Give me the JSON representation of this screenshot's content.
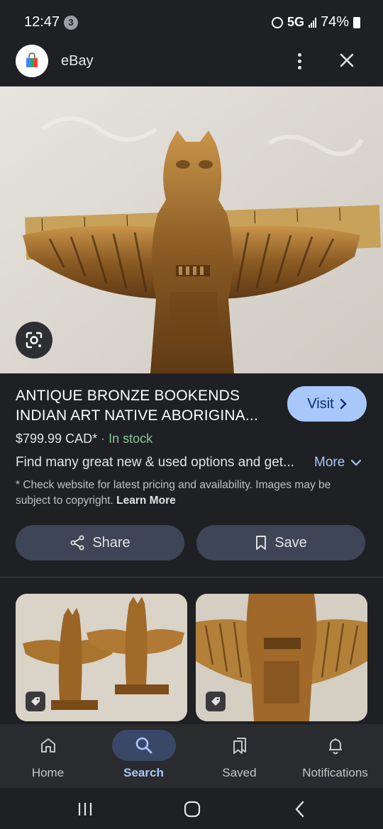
{
  "status_bar": {
    "time": "12:47",
    "notification_count": "3",
    "network": "5G",
    "battery": "74%"
  },
  "header": {
    "title": "eBay",
    "logo_icon": "google-lens-shopping-bag-icon",
    "menu_icon": "more-vert-icon",
    "close_icon": "close-icon"
  },
  "hero_image": {
    "subject": "bronze totem figure with ruler",
    "lens_icon": "google-lens-icon"
  },
  "product": {
    "title": "ANTIQUE BRONZE BOOKENDS INDIAN ART NATIVE ABORIGINA...",
    "visit_label": "Visit",
    "price": "$799.99 CAD*",
    "separator": "·",
    "stock": "In stock",
    "description": "Find many great new & used options and get...",
    "more_label": "More",
    "disclaimer": "* Check website for latest pricing and availability. Images may be subject to copyright.",
    "learn_more": "Learn More"
  },
  "actions": {
    "share_label": "Share",
    "save_label": "Save"
  },
  "related": [
    {
      "name": "related-thumb-pair",
      "tag_icon": "tag-icon"
    },
    {
      "name": "related-thumb-closeup",
      "tag_icon": "tag-icon"
    }
  ],
  "bottom_nav": {
    "items": [
      {
        "label": "Home",
        "icon": "home-icon",
        "active": false
      },
      {
        "label": "Search",
        "icon": "search-icon",
        "active": true
      },
      {
        "label": "Saved",
        "icon": "bookmarks-icon",
        "active": false
      },
      {
        "label": "Notifications",
        "icon": "bell-icon",
        "active": false
      }
    ]
  },
  "colors": {
    "background": "#1f2023",
    "accent": "#a8c7fa",
    "in_stock": "#81c995",
    "button_bg": "#3d4556"
  }
}
